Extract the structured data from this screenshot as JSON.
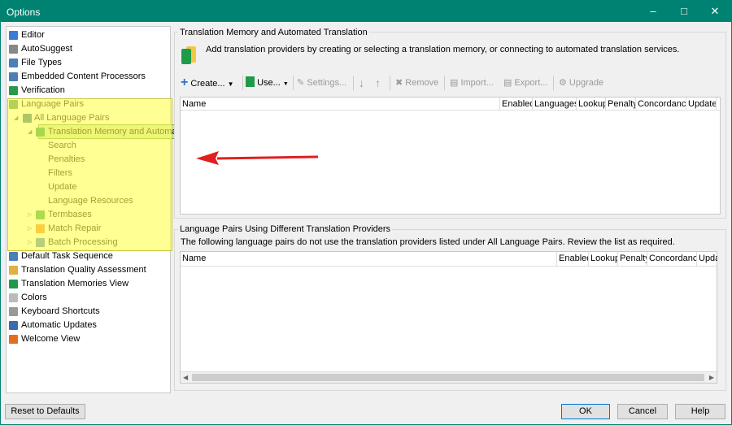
{
  "window": {
    "title": "Options",
    "minimize_icon": "minimize-icon",
    "maximize_icon": "maximize-icon",
    "close_icon": "close-icon"
  },
  "tree": [
    {
      "label": "Editor",
      "icon": "pencil-icon",
      "level": 0
    },
    {
      "label": "AutoSuggest",
      "icon": "autosuggest-icon",
      "level": 0
    },
    {
      "label": "File Types",
      "icon": "file-gear-icon",
      "level": 0
    },
    {
      "label": "Embedded Content Processors",
      "icon": "file-gear-icon",
      "level": 0
    },
    {
      "label": "Verification",
      "icon": "check-document-icon",
      "level": 0
    },
    {
      "label": "Language Pairs",
      "icon": "language-pairs-icon",
      "level": 0
    },
    {
      "label": "All Language Pairs",
      "icon": "flag-icon",
      "level": 1,
      "expanded": true
    },
    {
      "label": "Translation Memory and Automate",
      "icon": "translation-memory-icon",
      "level": 2,
      "expanded": true,
      "selected": true
    },
    {
      "label": "Search",
      "level": 3
    },
    {
      "label": "Penalties",
      "level": 3
    },
    {
      "label": "Filters",
      "level": 3
    },
    {
      "label": "Update",
      "level": 3
    },
    {
      "label": "Language Resources",
      "level": 3
    },
    {
      "label": "Termbases",
      "icon": "termbase-icon",
      "level": 2,
      "expanded": false
    },
    {
      "label": "Match Repair",
      "icon": "wrench-icon",
      "level": 2,
      "expanded": false
    },
    {
      "label": "Batch Processing",
      "icon": "batch-gear-icon",
      "level": 2,
      "expanded": false
    },
    {
      "label": "Default Task Sequence",
      "icon": "gear-icon",
      "level": 0
    },
    {
      "label": "Translation Quality Assessment",
      "icon": "clipboard-icon",
      "level": 0
    },
    {
      "label": "Translation Memories View",
      "icon": "translation-memory-icon",
      "level": 0
    },
    {
      "label": "Colors",
      "icon": "palette-icon",
      "level": 0
    },
    {
      "label": "Keyboard Shortcuts",
      "icon": "keyboard-icon",
      "level": 0
    },
    {
      "label": "Automatic Updates",
      "icon": "computer-update-icon",
      "level": 0
    },
    {
      "label": "Welcome View",
      "icon": "home-icon",
      "level": 0
    }
  ],
  "tm_group": {
    "title": "Translation Memory and Automated Translation",
    "description": "Add translation providers by creating or selecting a translation memory, or connecting to automated translation services.",
    "toolbar": {
      "create": "Create...",
      "use": "Use...",
      "settings": "Settings...",
      "remove": "Remove",
      "import": "Import...",
      "export": "Export...",
      "upgrade": "Upgrade"
    },
    "columns": [
      "Name",
      "Enabled",
      "Languages",
      "Lookup",
      "Penalty",
      "Concordance",
      "Update"
    ]
  },
  "lp_group": {
    "title": "Language Pairs Using Different Translation Providers",
    "description": "The following language pairs do not use the translation providers listed under All Language Pairs. Review the list as required.",
    "columns": [
      "Name",
      "Enabled",
      "Lookup",
      "Penalty",
      "Concordance",
      "Upda"
    ]
  },
  "buttons": {
    "reset": "Reset to Defaults",
    "ok": "OK",
    "cancel": "Cancel",
    "help": "Help"
  },
  "colors": {
    "titlebar": "#008272",
    "highlight": "#ffff50",
    "arrow": "#e02020"
  }
}
